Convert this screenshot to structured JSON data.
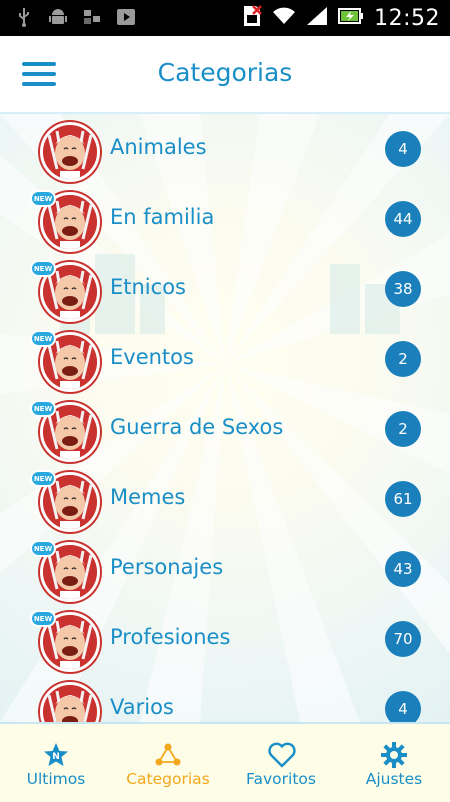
{
  "status_bar": {
    "time": "12:52",
    "icons": [
      "usb-icon",
      "android-debug-icon",
      "sd-card-icon",
      "play-store-icon",
      "no-sim-icon",
      "wifi-icon",
      "signal-icon",
      "battery-charging-icon"
    ]
  },
  "header": {
    "title": "Categorias",
    "menu_icon": "hamburger-menu-icon"
  },
  "colors": {
    "accent": "#1a8ec7",
    "active_tab": "#f2a81c",
    "badge": "#1a7fbb",
    "new_badge": "#29a8e0"
  },
  "categories": [
    {
      "label": "Animales",
      "count": "4",
      "is_new": false
    },
    {
      "label": "En familia",
      "count": "44",
      "is_new": true
    },
    {
      "label": "Etnicos",
      "count": "38",
      "is_new": true
    },
    {
      "label": "Eventos",
      "count": "2",
      "is_new": true
    },
    {
      "label": "Guerra de Sexos",
      "count": "2",
      "is_new": true
    },
    {
      "label": "Memes",
      "count": "61",
      "is_new": true
    },
    {
      "label": "Personajes",
      "count": "43",
      "is_new": true
    },
    {
      "label": "Profesiones",
      "count": "70",
      "is_new": true
    },
    {
      "label": "Varios",
      "count": "4",
      "is_new": false
    }
  ],
  "new_badge_text": "NEW",
  "tabs": [
    {
      "label": "Ultimos",
      "icon": "star-icon",
      "active": false
    },
    {
      "label": "Categorias",
      "icon": "share-nodes-icon",
      "active": true
    },
    {
      "label": "Favoritos",
      "icon": "heart-icon",
      "active": false
    },
    {
      "label": "Ajustes",
      "icon": "gear-icon",
      "active": false
    }
  ]
}
